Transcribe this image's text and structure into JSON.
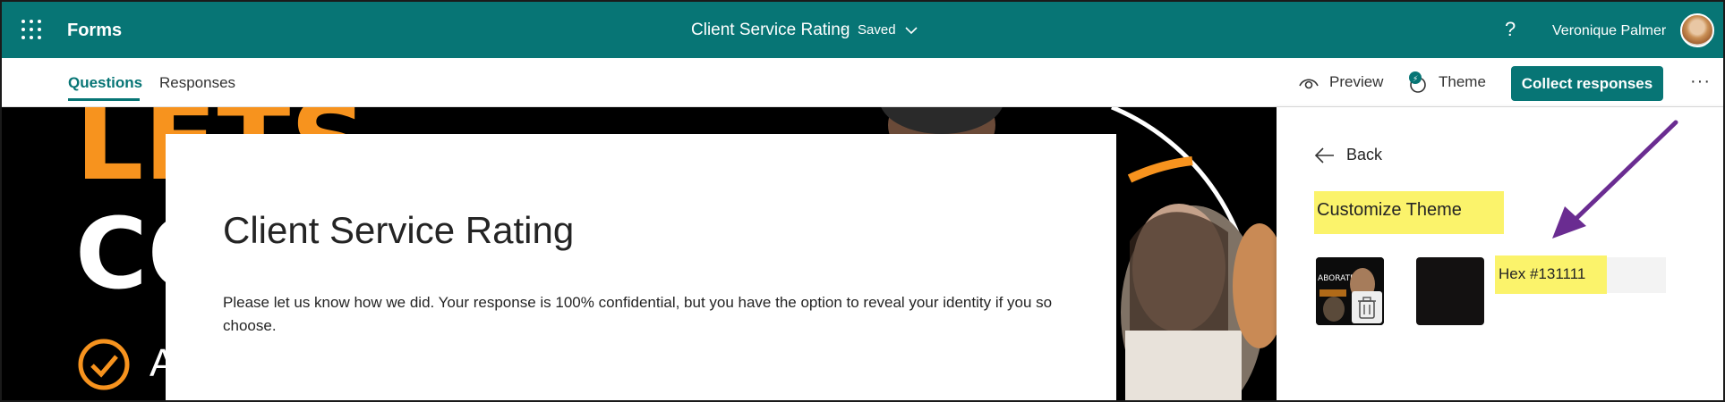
{
  "header": {
    "app_name": "Forms",
    "doc_title": "Client Service Rating",
    "doc_separator": "-",
    "doc_status": "Saved",
    "help_label": "?",
    "user_name": "Veronique Palmer"
  },
  "nav": {
    "tabs": [
      {
        "label": "Questions",
        "active": true
      },
      {
        "label": "Responses",
        "active": false
      }
    ],
    "preview_label": "Preview",
    "theme_label": "Theme",
    "collect_label": "Collect responses",
    "more_label": "···"
  },
  "background": {
    "word1": "LETS",
    "word2": "CO",
    "word3": "A"
  },
  "form": {
    "title": "Client Service Rating",
    "description": "Please let us know how we did. Your response is 100% confidential, but you have the option to reveal your identity if you so choose."
  },
  "theme_pane": {
    "back_label": "Back",
    "title": "Customize Theme",
    "hex_label": "Hex #131111",
    "thumbnail_text": "ABORATE"
  },
  "colors": {
    "brand": "#077575",
    "highlight": "#fbf36b",
    "theme_color": "#131111",
    "accent_orange": "#f7931e",
    "annotation_arrow": "#6a2c91"
  },
  "icons": [
    "waffle-icon",
    "chevron-down-icon",
    "help-icon",
    "eye-icon",
    "palette-icon",
    "more-icon",
    "back-arrow-icon",
    "trash-icon"
  ]
}
